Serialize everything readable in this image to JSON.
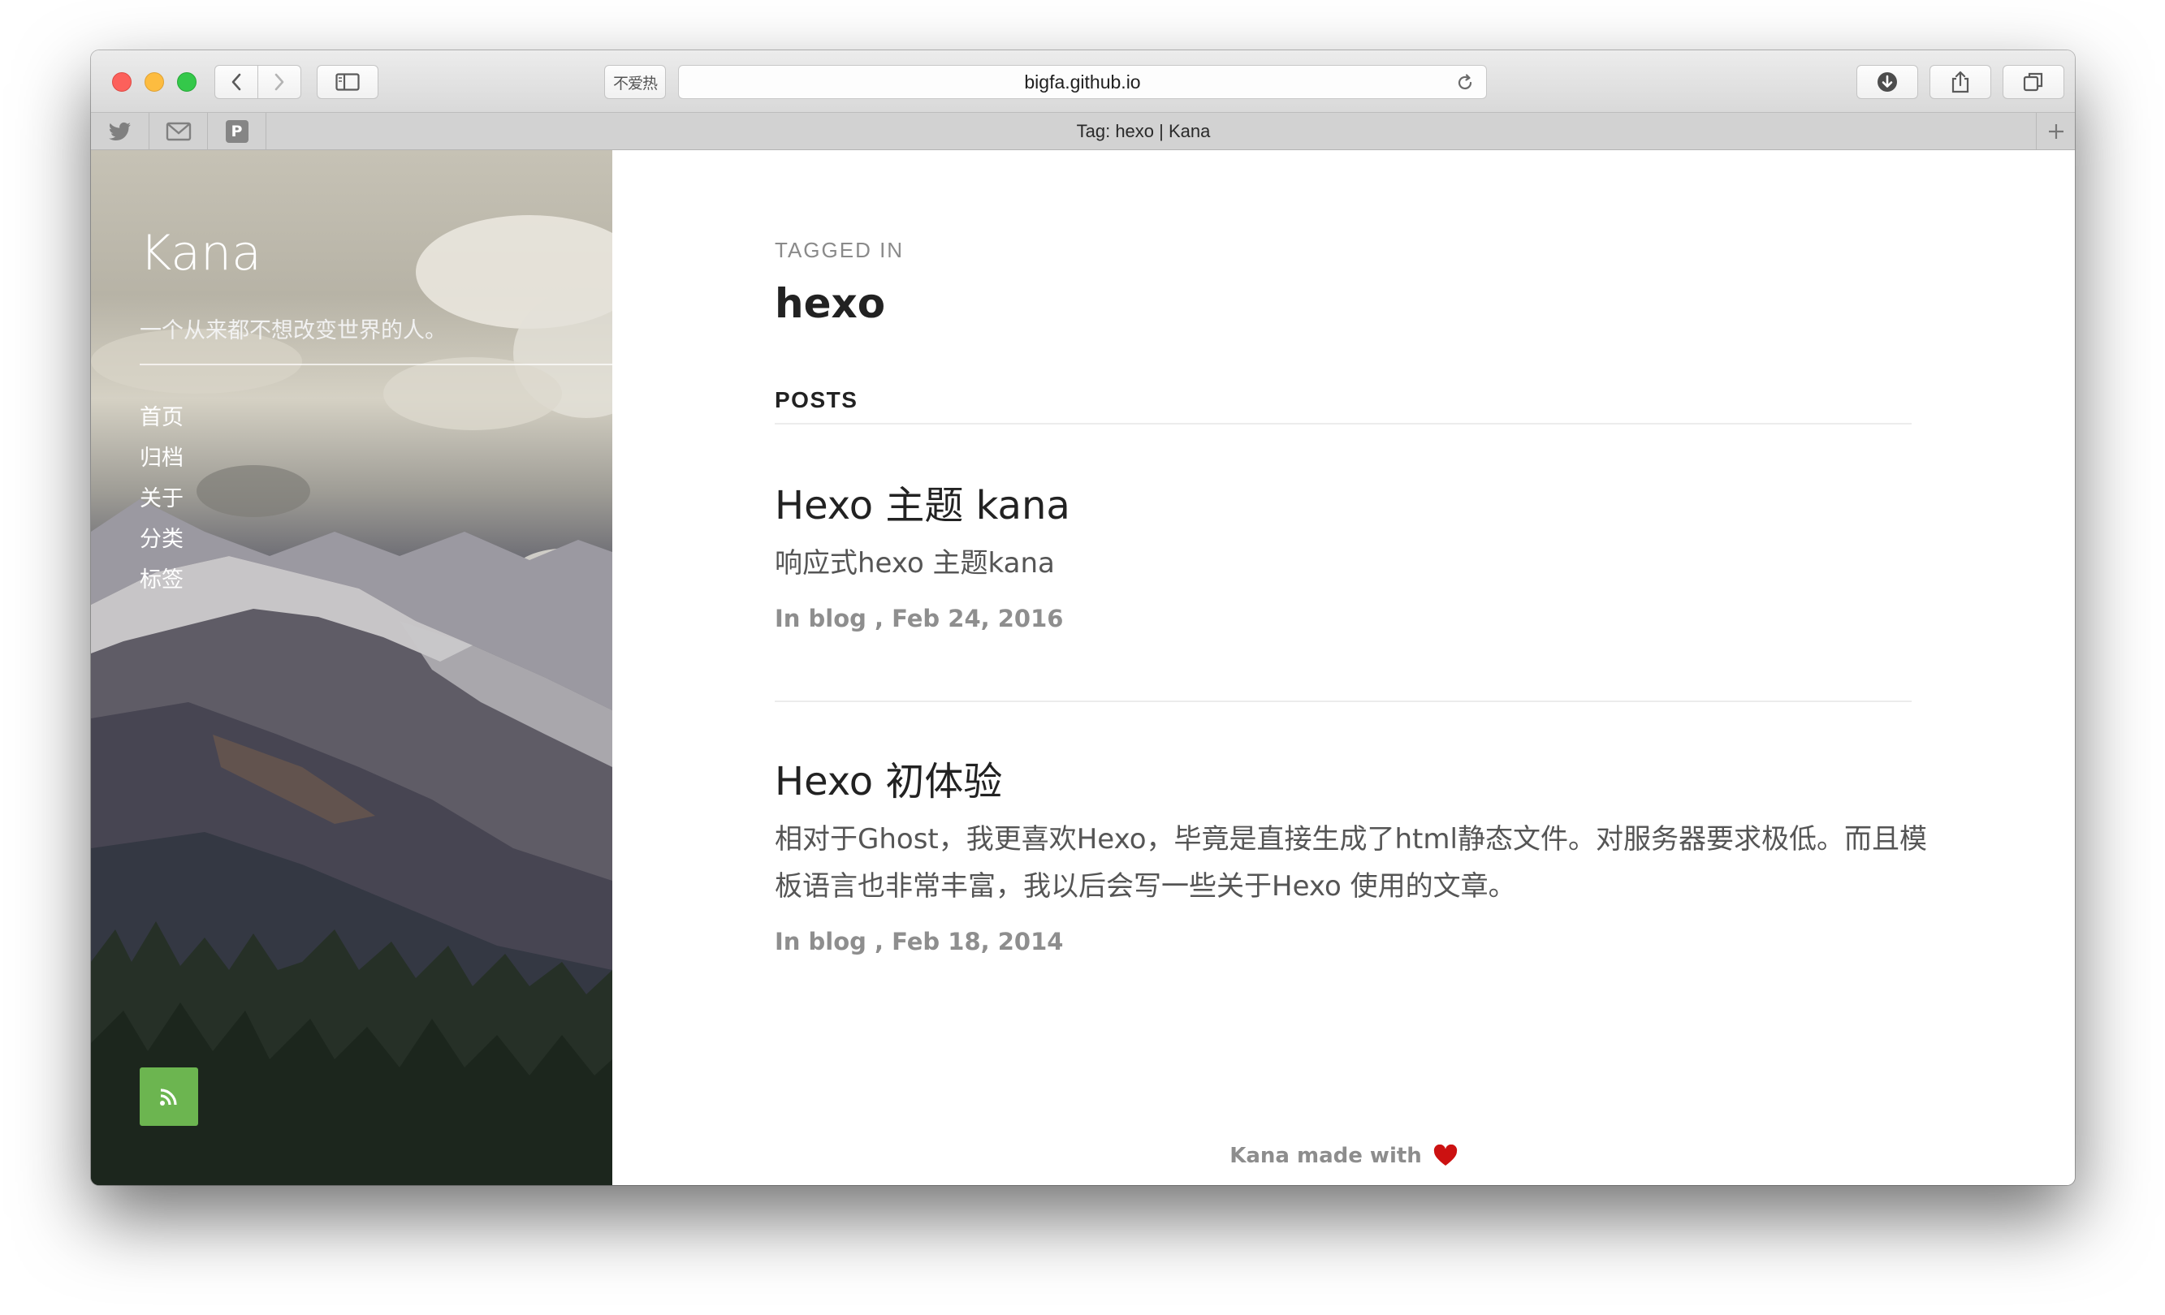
{
  "browser": {
    "url": "bigfa.github.io",
    "tab_title": "Tag: hexo | Kana",
    "extension_label": "不爱热",
    "favorites": [
      "twitter-icon",
      "mail-icon",
      "P"
    ]
  },
  "sidebar": {
    "site_title": "Kana",
    "site_description": "一个从来都不想改变世界的人。",
    "nav": [
      {
        "label": "首页"
      },
      {
        "label": "归档"
      },
      {
        "label": "关于"
      },
      {
        "label": "分类"
      },
      {
        "label": "标签"
      }
    ],
    "rss_icon": "rss-icon",
    "rss_color": "#6cb550"
  },
  "main": {
    "tagged_label": "TAGGED IN",
    "tag_name": "hexo",
    "posts_label": "POSTS",
    "posts": [
      {
        "title": "Hexo 主题 kana",
        "excerpt": "响应式hexo 主题kana",
        "meta": "In blog , Feb 24, 2016"
      },
      {
        "title": "Hexo 初体验",
        "excerpt": "相对于Ghost，我更喜欢Hexo，毕竟是直接生成了html静态文件。对服务器要求极低。而且模板语言也非常丰富，我以后会写一些关于Hexo 使用的文章。",
        "meta": "In blog , Feb 18, 2014"
      }
    ]
  },
  "footer": {
    "text": "Kana made with",
    "heart_color": "#cc1111"
  }
}
